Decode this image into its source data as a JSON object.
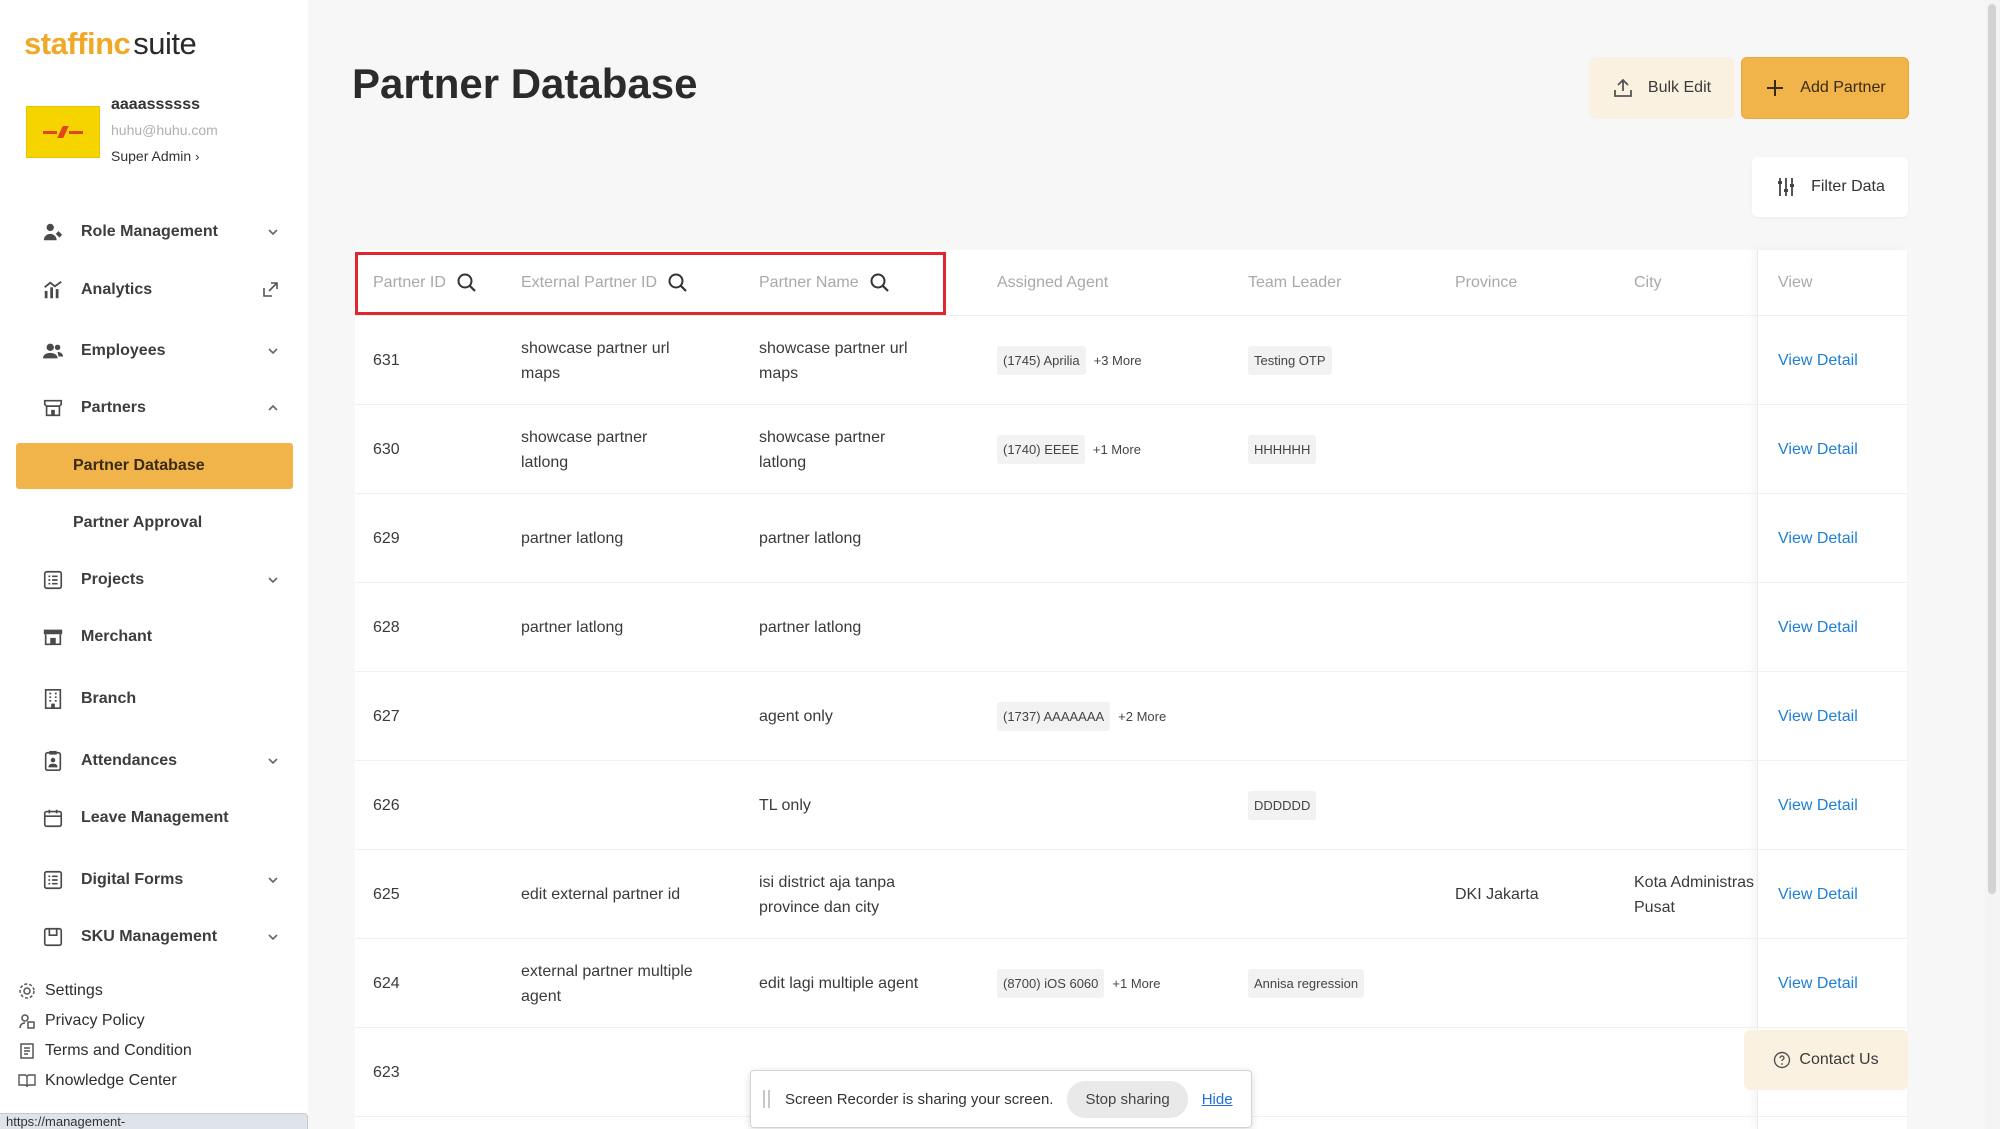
{
  "brand": {
    "name": "staffinc",
    "suffix": "suite"
  },
  "profile": {
    "name": "aaaassssss",
    "email": "huhu@huhu.com",
    "role": "Super Admin",
    "role_chevron": "›"
  },
  "sidebar": {
    "items": [
      {
        "label": "Role Management",
        "icon": "role-management-icon"
      },
      {
        "label": "Analytics",
        "icon": "analytics-icon"
      },
      {
        "label": "Employees",
        "icon": "employees-icon"
      },
      {
        "label": "Partners",
        "icon": "partners-icon"
      },
      {
        "label": "Projects",
        "icon": "projects-icon"
      },
      {
        "label": "Merchant",
        "icon": "merchant-icon"
      },
      {
        "label": "Branch",
        "icon": "branch-icon"
      },
      {
        "label": "Attendances",
        "icon": "attendances-icon"
      },
      {
        "label": "Leave Management",
        "icon": "leave-management-icon"
      },
      {
        "label": "Digital Forms",
        "icon": "digital-forms-icon"
      },
      {
        "label": "SKU Management",
        "icon": "sku-management-icon"
      }
    ],
    "sub_items": [
      {
        "label": "Partner Database",
        "active": true
      },
      {
        "label": "Partner Approval",
        "active": false
      }
    ],
    "footer": [
      {
        "label": "Settings",
        "icon": "settings-icon"
      },
      {
        "label": "Privacy Policy",
        "icon": "privacy-icon"
      },
      {
        "label": "Terms and Condition",
        "icon": "terms-icon"
      },
      {
        "label": "Knowledge Center",
        "icon": "book-icon"
      }
    ]
  },
  "status_bar_url": "https://management-stg.staffincsuite.co/partners/database",
  "page": {
    "title": "Partner Database",
    "bulk_edit_label": "Bulk Edit",
    "add_partner_label": "Add Partner",
    "filter_label": "Filter Data"
  },
  "table": {
    "columns": [
      "Partner ID",
      "External Partner ID",
      "Partner Name",
      "Assigned Agent",
      "Team Leader",
      "Province",
      "City",
      "View"
    ],
    "rows": [
      {
        "id": "631",
        "ext": "showcase partner url maps",
        "name": "showcase partner url maps",
        "agent": "(1745) Aprilia",
        "agent_more": "+3 More",
        "leader": "Testing OTP",
        "province": "",
        "city": "",
        "view": "View Detail"
      },
      {
        "id": "630",
        "ext": "showcase partner latlong",
        "name": "showcase partner latlong",
        "agent": "(1740) EEEE",
        "agent_more": "+1 More",
        "leader": "HHHHHH",
        "province": "",
        "city": "",
        "view": "View Detail"
      },
      {
        "id": "629",
        "ext": "partner latlong",
        "name": "partner latlong",
        "agent": "",
        "agent_more": "",
        "leader": "",
        "province": "",
        "city": "",
        "view": "View Detail"
      },
      {
        "id": "628",
        "ext": "partner latlong",
        "name": "partner latlong",
        "agent": "",
        "agent_more": "",
        "leader": "",
        "province": "",
        "city": "",
        "view": "View Detail"
      },
      {
        "id": "627",
        "ext": "",
        "name": "agent only",
        "agent": "(1737) AAAAAAA",
        "agent_more": "+2 More",
        "leader": "",
        "province": "",
        "city": "",
        "view": "View Detail"
      },
      {
        "id": "626",
        "ext": "",
        "name": "TL only",
        "agent": "",
        "agent_more": "",
        "leader": "DDDDDD",
        "province": "",
        "city": "",
        "view": "View Detail"
      },
      {
        "id": "625",
        "ext": "edit external partner id",
        "name": "isi district aja tanpa province dan city",
        "agent": "",
        "agent_more": "",
        "leader": "",
        "province": "DKI Jakarta",
        "city": "Kota Administras Pusat",
        "view": "View Detail"
      },
      {
        "id": "624",
        "ext": "external partner multiple agent",
        "name": "edit lagi multiple agent",
        "agent": "(8700) iOS 6060",
        "agent_more": "+1 More",
        "leader": "Annisa regression",
        "province": "",
        "city": "",
        "view": "View Detail"
      },
      {
        "id": "623",
        "ext": "",
        "name": "",
        "agent": "",
        "agent_more": "",
        "leader": "",
        "province": "",
        "city": "",
        "view": ""
      }
    ]
  },
  "contact": {
    "label": "Contact Us"
  },
  "recorder": {
    "message": "Screen Recorder is sharing your screen.",
    "stop_label": "Stop sharing",
    "hide_label": "Hide"
  },
  "colors": {
    "accent": "#f0b44a",
    "link": "#1e7fd6",
    "highlight": "#e0262e"
  }
}
